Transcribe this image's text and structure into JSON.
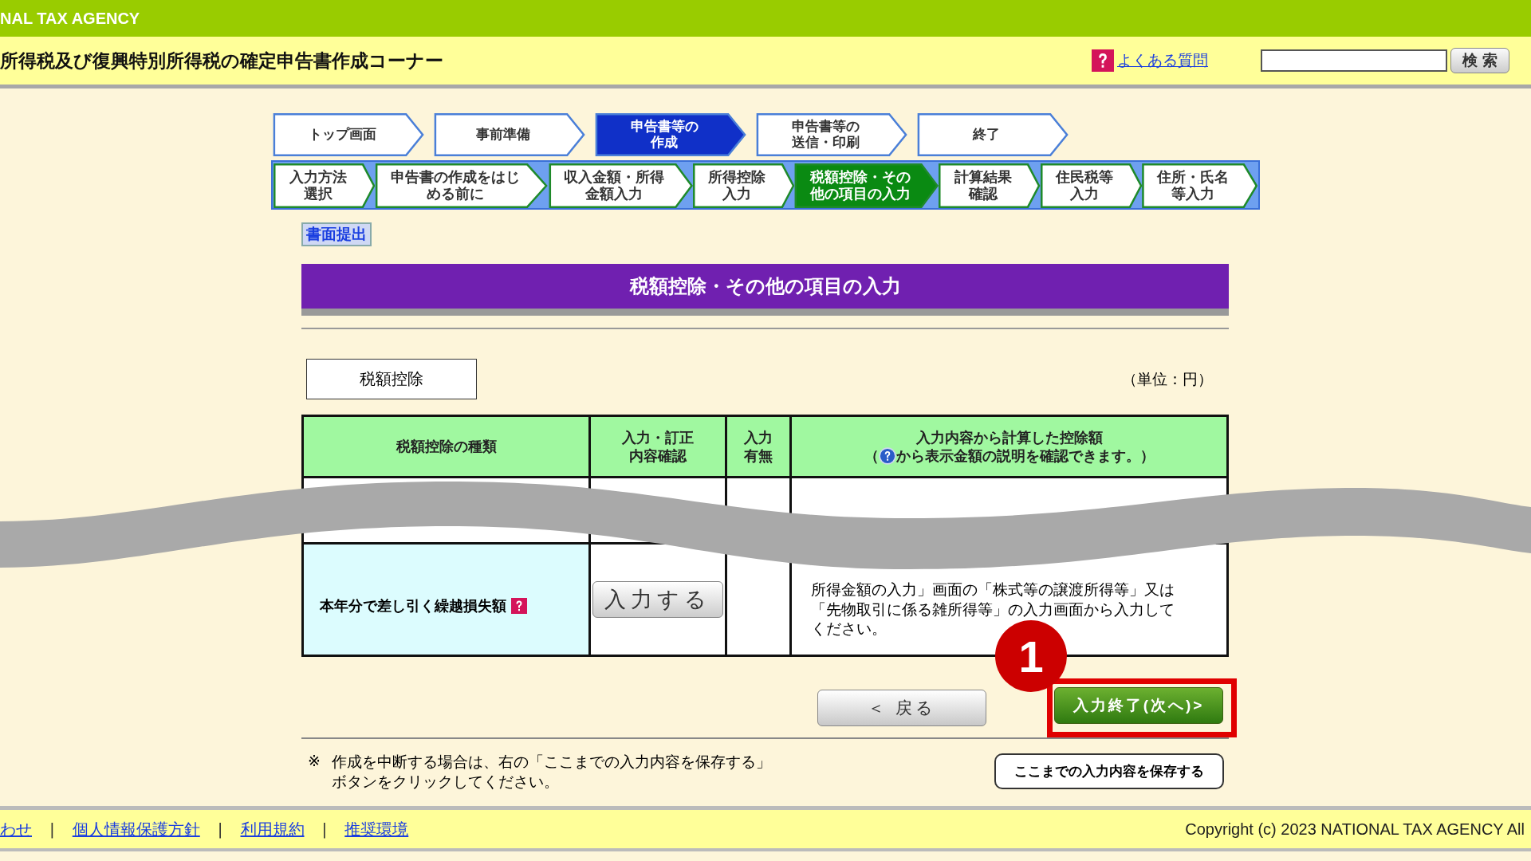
{
  "agency_bar": {
    "text": "NAL TAX AGENCY"
  },
  "header": {
    "title": "所得税及び復興特別所得税の確定申告書作成コーナー",
    "faq_link": "よくある質問",
    "search": {
      "button": "検 索"
    }
  },
  "main_steps": [
    {
      "lines": [
        "トップ画面"
      ],
      "selected": false
    },
    {
      "lines": [
        "事前準備"
      ],
      "selected": false
    },
    {
      "lines": [
        "申告書等の",
        "作成"
      ],
      "selected": true
    },
    {
      "lines": [
        "申告書等の",
        "送信・印刷"
      ],
      "selected": false
    },
    {
      "lines": [
        "終了"
      ],
      "selected": false
    }
  ],
  "sub_steps": [
    {
      "lines": [
        "入力方法",
        "選択"
      ],
      "selected": false
    },
    {
      "lines": [
        "申告書の作成をはじ",
        "める前に"
      ],
      "selected": false
    },
    {
      "lines": [
        "収入金額・所得",
        "金額入力"
      ],
      "selected": false
    },
    {
      "lines": [
        "所得控除",
        "入力"
      ],
      "selected": false
    },
    {
      "lines": [
        "税額控除・その",
        "他の項目の入力"
      ],
      "selected": true
    },
    {
      "lines": [
        "計算結果",
        "確認"
      ],
      "selected": false
    },
    {
      "lines": [
        "住民税等",
        "入力"
      ],
      "selected": false
    },
    {
      "lines": [
        "住所・氏名",
        "等入力"
      ],
      "selected": false
    }
  ],
  "paper_submission_tag": "書面提出",
  "page_title": "税額控除・その他の項目の入力",
  "section_label": "税額控除",
  "unit_note": "（単位：円）",
  "table": {
    "columns": [
      "税額控除の種類",
      [
        "入力・訂正",
        "内容確認"
      ],
      [
        "入力",
        "有無"
      ],
      {
        "title": "入力内容から計算した控除額",
        "hint_open": "（",
        "hint": "から表示金額の説明を確認できます。）"
      }
    ],
    "rows": [
      {
        "label": "本年分で差し引く繰越損失額",
        "button": "入力する",
        "description": [
          "所得金額の入力」画面の「株式等の譲渡所得等」又は",
          "「先物取引に係る雑所得等」の入力画面から入力して",
          "ください。"
        ]
      }
    ]
  },
  "buttons": {
    "back": "＜ 戻る",
    "next": "入力終了(次へ)>"
  },
  "annotation": {
    "number": "1"
  },
  "note": {
    "mark": "※",
    "text": "作成を中断する場合は、右の「ここまでの入力内容を保存する」ボタンをクリックしてください。"
  },
  "save_button": "ここまでの入力内容を保存する",
  "footer": {
    "links": [
      "わせ",
      "個人情報保護方針",
      "利用規約",
      "推奨環境"
    ],
    "separator": "|",
    "copyright": "Copyright (c) 2023 NATIONAL TAX AGENCY All"
  }
}
